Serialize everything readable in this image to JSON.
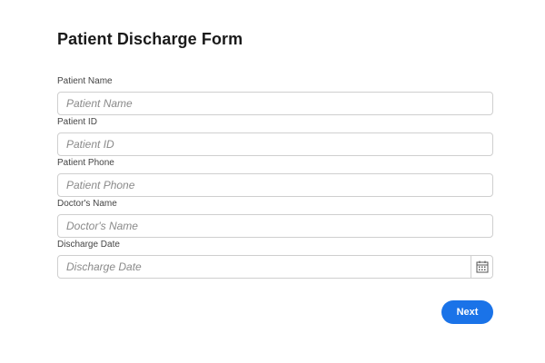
{
  "form": {
    "title": "Patient Discharge Form",
    "fields": [
      {
        "label": "Patient Name",
        "placeholder": "Patient Name",
        "value": ""
      },
      {
        "label": "Patient ID",
        "placeholder": "Patient ID",
        "value": ""
      },
      {
        "label": "Patient Phone",
        "placeholder": "Patient Phone",
        "value": ""
      },
      {
        "label": "Doctor's Name",
        "placeholder": "Doctor's Name",
        "value": ""
      },
      {
        "label": "Discharge Date",
        "placeholder": "Discharge Date",
        "value": ""
      }
    ],
    "next_label": "Next"
  },
  "icons": {
    "calendar": "calendar-icon"
  },
  "colors": {
    "accent": "#1a73e8",
    "border": "#cfcfcf",
    "text": "#1a1a1a"
  }
}
